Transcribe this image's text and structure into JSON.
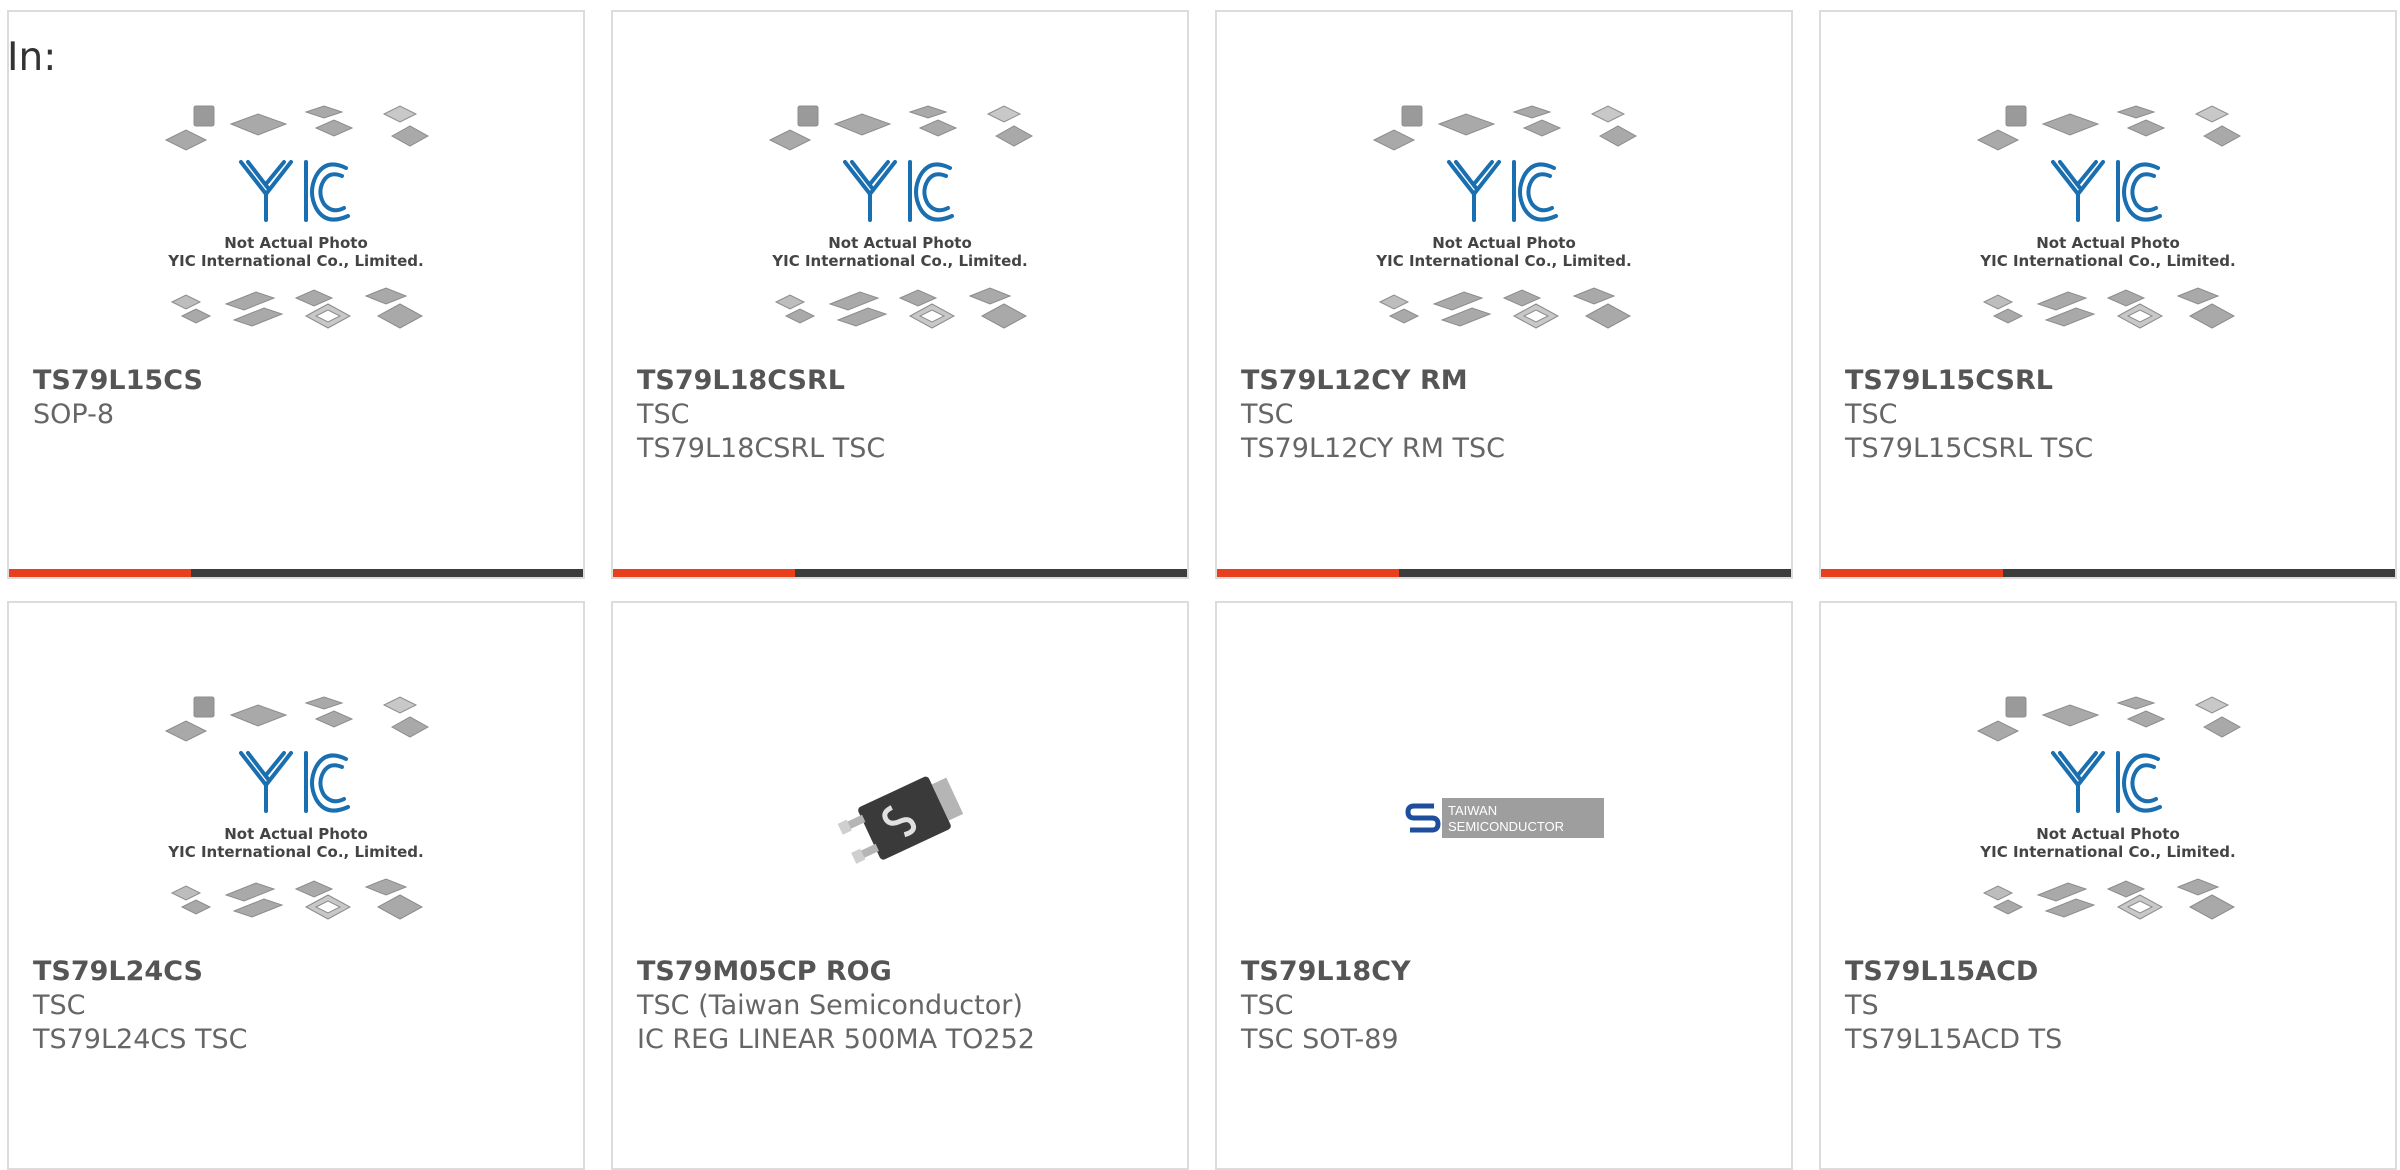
{
  "header": {
    "label": "In:"
  },
  "products": [
    {
      "name": "TS79L15CS",
      "lines": [
        "SOP-8"
      ],
      "image": "yic-placeholder",
      "has_bar": true
    },
    {
      "name": "TS79L18CSRL",
      "lines": [
        "TSC",
        "TS79L18CSRL TSC"
      ],
      "image": "yic-placeholder",
      "has_bar": true
    },
    {
      "name": "TS79L12CY RM",
      "lines": [
        "TSC",
        "TS79L12CY RM TSC"
      ],
      "image": "yic-placeholder",
      "has_bar": true
    },
    {
      "name": "TS79L15CSRL",
      "lines": [
        "TSC",
        "TS79L15CSRL TSC"
      ],
      "image": "yic-placeholder",
      "has_bar": true
    },
    {
      "name": "TS79L24CS",
      "lines": [
        "TSC",
        "TS79L24CS TSC"
      ],
      "image": "yic-placeholder",
      "has_bar": false
    },
    {
      "name": "TS79M05CP ROG",
      "lines": [
        "TSC (Taiwan Semiconductor)",
        "IC REG LINEAR 500MA TO252"
      ],
      "image": "chip-photo",
      "has_bar": false
    },
    {
      "name": "TS79L18CY",
      "lines": [
        "TSC",
        "TSC SOT-89"
      ],
      "image": "taiwan-semi-logo",
      "has_bar": false
    },
    {
      "name": "TS79L15ACD",
      "lines": [
        "TS",
        "TS79L15ACD TS"
      ],
      "image": "yic-placeholder",
      "has_bar": false
    }
  ],
  "placeholder": {
    "caption_1": "Not Actual Photo",
    "caption_2": "YIC International Co., Limited.",
    "logo_text": "YIC"
  },
  "tsc_logo": {
    "line_1": "TAIWAN",
    "line_2": "SEMICONDUCTOR"
  },
  "colors": {
    "accent_bar": "#e8401c",
    "bar_dark": "#3c3c3c",
    "card_border": "#dcdcdc",
    "yic_blue": "#1a6fb0"
  }
}
